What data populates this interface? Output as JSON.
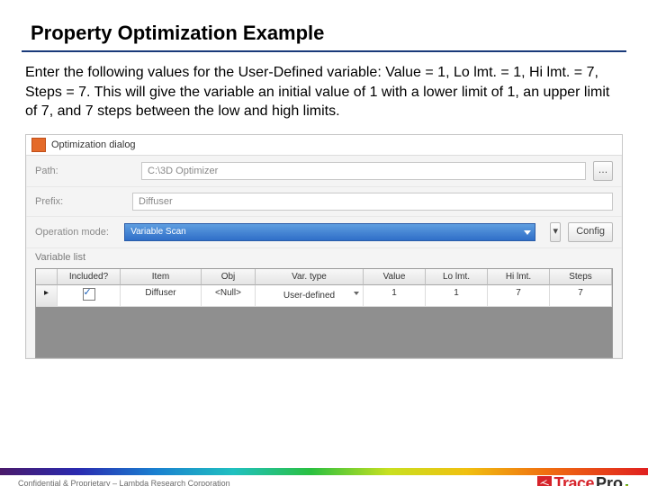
{
  "title": "Property Optimization Example",
  "body_text": "Enter the following values for the User-Defined variable: Value = 1, Lo lmt. = 1, Hi lmt. = 7, Steps = 7. This will give the variable an initial value of 1 with a lower limit of 1, an upper limit of 7, and 7 steps between the low and high limits.",
  "dialog": {
    "window_title": "Optimization dialog",
    "labels": {
      "path": "Path:",
      "prefix": "Prefix:",
      "operation_mode": "Operation mode:",
      "variable_list": "Variable list"
    },
    "path_value": "C:\\3D Optimizer",
    "prefix_value": "Diffuser",
    "operation_mode_value": "Variable Scan",
    "browse_btn": "…",
    "config_btn": "Config",
    "columns": {
      "row_header": "",
      "included": "Included?",
      "item": "Item",
      "obj": "Obj",
      "var_type": "Var. type",
      "value": "Value",
      "lo_lmt": "Lo lmt.",
      "hi_lmt": "Hi lmt.",
      "steps": "Steps"
    },
    "row": {
      "marker": "▸",
      "included": true,
      "item": "Diffuser",
      "obj": "<Null>",
      "var_type": "User-defined",
      "value": "1",
      "lo_lmt": "1",
      "hi_lmt": "7",
      "steps": "7"
    }
  },
  "footer": {
    "confidential": "Confidential & Proprietary – Lambda Research Corporation",
    "logo_trace": "Trace",
    "logo_pro": "Pro"
  }
}
